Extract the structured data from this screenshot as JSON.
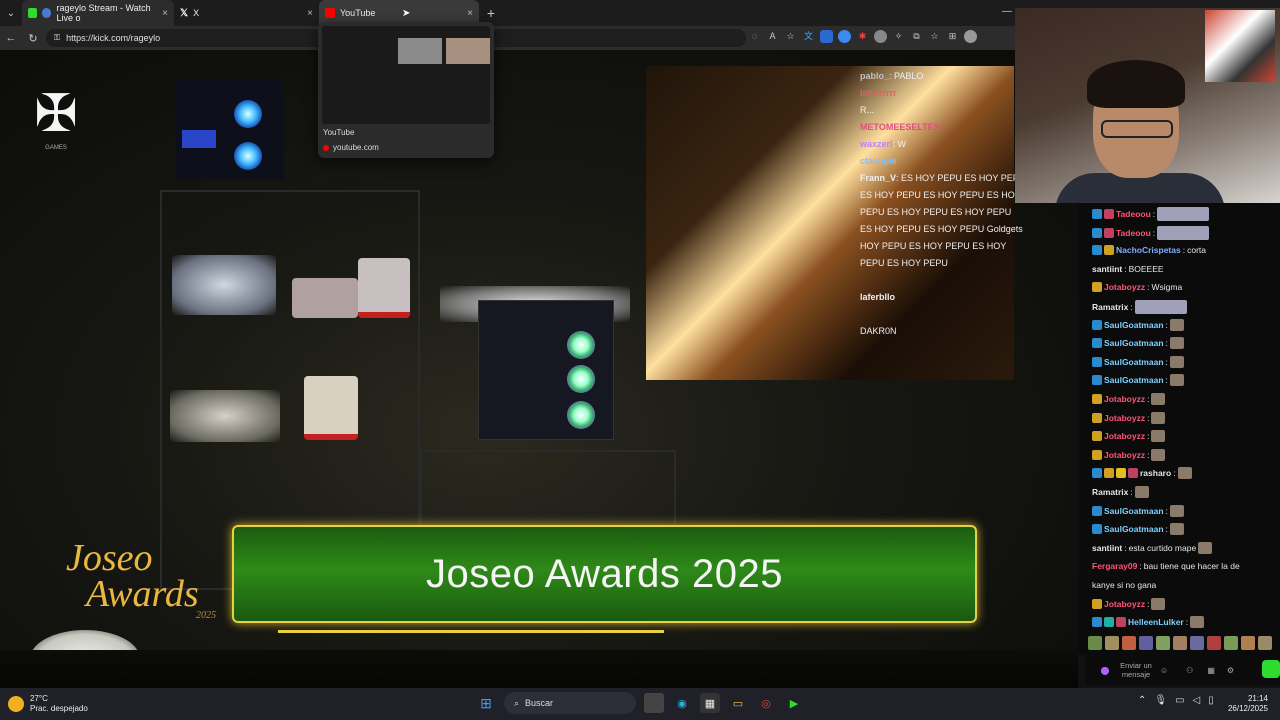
{
  "browser": {
    "tabs": [
      {
        "label": "rageylo Stream - Watch Live o",
        "favicon_color": "#2ddc2d",
        "active": false
      },
      {
        "label": "X",
        "favicon_color": "#000000",
        "active": false
      },
      {
        "label": "YouTube",
        "favicon_color": "#ff0000",
        "active": true
      }
    ],
    "close_glyph": "×",
    "new_tab_glyph": "+",
    "url": "https://kick.com/rageylo",
    "minimize_glyph": "—"
  },
  "tab_preview": {
    "title": "YouTube",
    "domain": "youtube.com"
  },
  "stream": {
    "lower_third_title": "Joseo Awards 2025",
    "wordmark_line1": "Joseo",
    "wordmark_line2": "Awards",
    "wordmark_year": "2025",
    "logo_caption": "GAMES"
  },
  "overlay_chat": [
    {
      "user": "pablo_",
      "text": "PABLO",
      "user_color": "#c0c0c0"
    },
    {
      "user": "laferrrrrr",
      "text": "",
      "user_color": "#e06060"
    },
    {
      "user": "",
      "text": "R...",
      "user_color": "#e06060"
    },
    {
      "user": "METOMEESELTES",
      "text": "",
      "user_color": "#e05080"
    },
    {
      "user": "waxzerl",
      "text": "W",
      "user_color": "#c080ff"
    },
    {
      "user": "ctasuple",
      "text": "",
      "user_color": "#80c0ff"
    },
    {
      "user": "Frann_V",
      "text": "ES HOY PEPU ES HOY PEPU",
      "user_color": "#f0f0f0"
    },
    {
      "user": "",
      "text": "ES HOY PEPU ES HOY PEPU ES HOY PEPU",
      "user_color": "#f0f0f0"
    },
    {
      "user": "",
      "text": "PEPU ES HOY PEPU ES HOY PEPU",
      "user_color": "#f0f0f0"
    },
    {
      "user": "",
      "text": "ES HOY PEPU ES HOY PEPU Goldgets",
      "user_color": "#f0f0f0"
    },
    {
      "user": "",
      "text": "HOY PEPU ES HOY PEPU ES HOY",
      "user_color": "#f0f0f0"
    },
    {
      "user": "",
      "text": "PEPU ES HOY PEPU",
      "user_color": "#f0f0f0"
    },
    {
      "user": "",
      "text": "",
      "user_color": "#c03030"
    },
    {
      "user": "laferbllo",
      "text": "",
      "user_color": "#c0c0c0"
    },
    {
      "user": "",
      "text": "",
      "user_color": "#c03030"
    },
    {
      "user": "",
      "text": "DAKR0N",
      "user_color": "#f0f0f0"
    },
    {
      "user": "",
      "text": "",
      "user_color": "#c03030"
    },
    {
      "user": "",
      "text": "",
      "user_color": "#c03030"
    }
  ],
  "chat": {
    "messages": [
      {
        "user": "Tadeoou",
        "text": "",
        "user_color": "#ff5577",
        "badges": [
          "#2a8ad0",
          "#c04060"
        ],
        "emote": "wide"
      },
      {
        "user": "Tadeoou",
        "text": "",
        "user_color": "#ff5577",
        "badges": [
          "#2a8ad0",
          "#c04060"
        ],
        "emote": "wide"
      },
      {
        "user": "NachoCrispetas",
        "text": "corta",
        "user_color": "#7fb0ff",
        "badges": [
          "#2a8ad0",
          "#d0a020"
        ],
        "emote": ""
      },
      {
        "user": "santiint",
        "text": "BOEEEE",
        "user_color": "#e6e6e6",
        "badges": [],
        "emote": ""
      },
      {
        "user": "Jotaboyzz",
        "text": "Wsigma",
        "user_color": "#ff5577",
        "badges": [
          "#d0a020"
        ],
        "emote": ""
      },
      {
        "user": "Ramatrix",
        "text": "",
        "user_color": "#e6e6e6",
        "badges": [],
        "emote": "wide"
      },
      {
        "user": "SaulGoatmaan",
        "text": "",
        "user_color": "#7fd0ff",
        "badges": [
          "#2a8ad0"
        ],
        "emote": "small"
      },
      {
        "user": "SaulGoatmaan",
        "text": "",
        "user_color": "#7fd0ff",
        "badges": [
          "#2a8ad0"
        ],
        "emote": "small"
      },
      {
        "user": "SaulGoatmaan",
        "text": "",
        "user_color": "#7fd0ff",
        "badges": [
          "#2a8ad0"
        ],
        "emote": "small"
      },
      {
        "user": "SaulGoatmaan",
        "text": "",
        "user_color": "#7fd0ff",
        "badges": [
          "#2a8ad0"
        ],
        "emote": "small"
      },
      {
        "user": "Jotaboyzz",
        "text": "",
        "user_color": "#ff5577",
        "badges": [
          "#d0a020"
        ],
        "emote": "small"
      },
      {
        "user": "Jotaboyzz",
        "text": "",
        "user_color": "#ff5577",
        "badges": [
          "#d0a020"
        ],
        "emote": "small"
      },
      {
        "user": "Jotaboyzz",
        "text": "",
        "user_color": "#ff5577",
        "badges": [
          "#d0a020"
        ],
        "emote": "small"
      },
      {
        "user": "Jotaboyzz",
        "text": "",
        "user_color": "#ff5577",
        "badges": [
          "#d0a020"
        ],
        "emote": "small"
      },
      {
        "user": "rasharo",
        "text": "",
        "user_color": "#e6e6e6",
        "badges": [
          "#2a8ad0",
          "#d0a020",
          "#e0c020",
          "#c04060"
        ],
        "emote": "small"
      },
      {
        "user": "Ramatrix",
        "text": "",
        "user_color": "#e6e6e6",
        "badges": [],
        "emote": "small"
      },
      {
        "user": "SaulGoatmaan",
        "text": "",
        "user_color": "#7fd0ff",
        "badges": [
          "#2a8ad0"
        ],
        "emote": "small"
      },
      {
        "user": "SaulGoatmaan",
        "text": "",
        "user_color": "#7fd0ff",
        "badges": [
          "#2a8ad0"
        ],
        "emote": "small"
      },
      {
        "user": "santiint",
        "text": "esta curtido mape",
        "user_color": "#e6e6e6",
        "badges": [],
        "emote": "small"
      },
      {
        "user": "Fergaray09",
        "text": "bau tiene que hacer la de",
        "user_color": "#ff5577",
        "badges": [],
        "emote": ""
      },
      {
        "user": "",
        "text": "kanye si no gana",
        "user_color": "#e6e6e6",
        "badges": [],
        "emote": ""
      },
      {
        "user": "Jotaboyzz",
        "text": "",
        "user_color": "#ff5577",
        "badges": [
          "#d0a020"
        ],
        "emote": "small"
      },
      {
        "user": "HelleenLulker",
        "text": "",
        "user_color": "#7fd0ff",
        "badges": [
          "#2a8ad0",
          "#20b0a0",
          "#c04060"
        ],
        "emote": "small"
      }
    ],
    "input_placeholder": "Enviar un mensaje",
    "emote_bar_colors": [
      "#6a8a4a",
      "#a09060",
      "#c06040",
      "#6060a0",
      "#80a060",
      "#a08060",
      "#6a6aa0",
      "#b04040",
      "#7a9a5a",
      "#b08050",
      "#9a8a6a"
    ]
  },
  "taskbar": {
    "temperature": "27°C",
    "weather_desc": "Prac. despejado",
    "search_label": "Buscar",
    "time": "21:14",
    "date": "26/12/2025"
  }
}
